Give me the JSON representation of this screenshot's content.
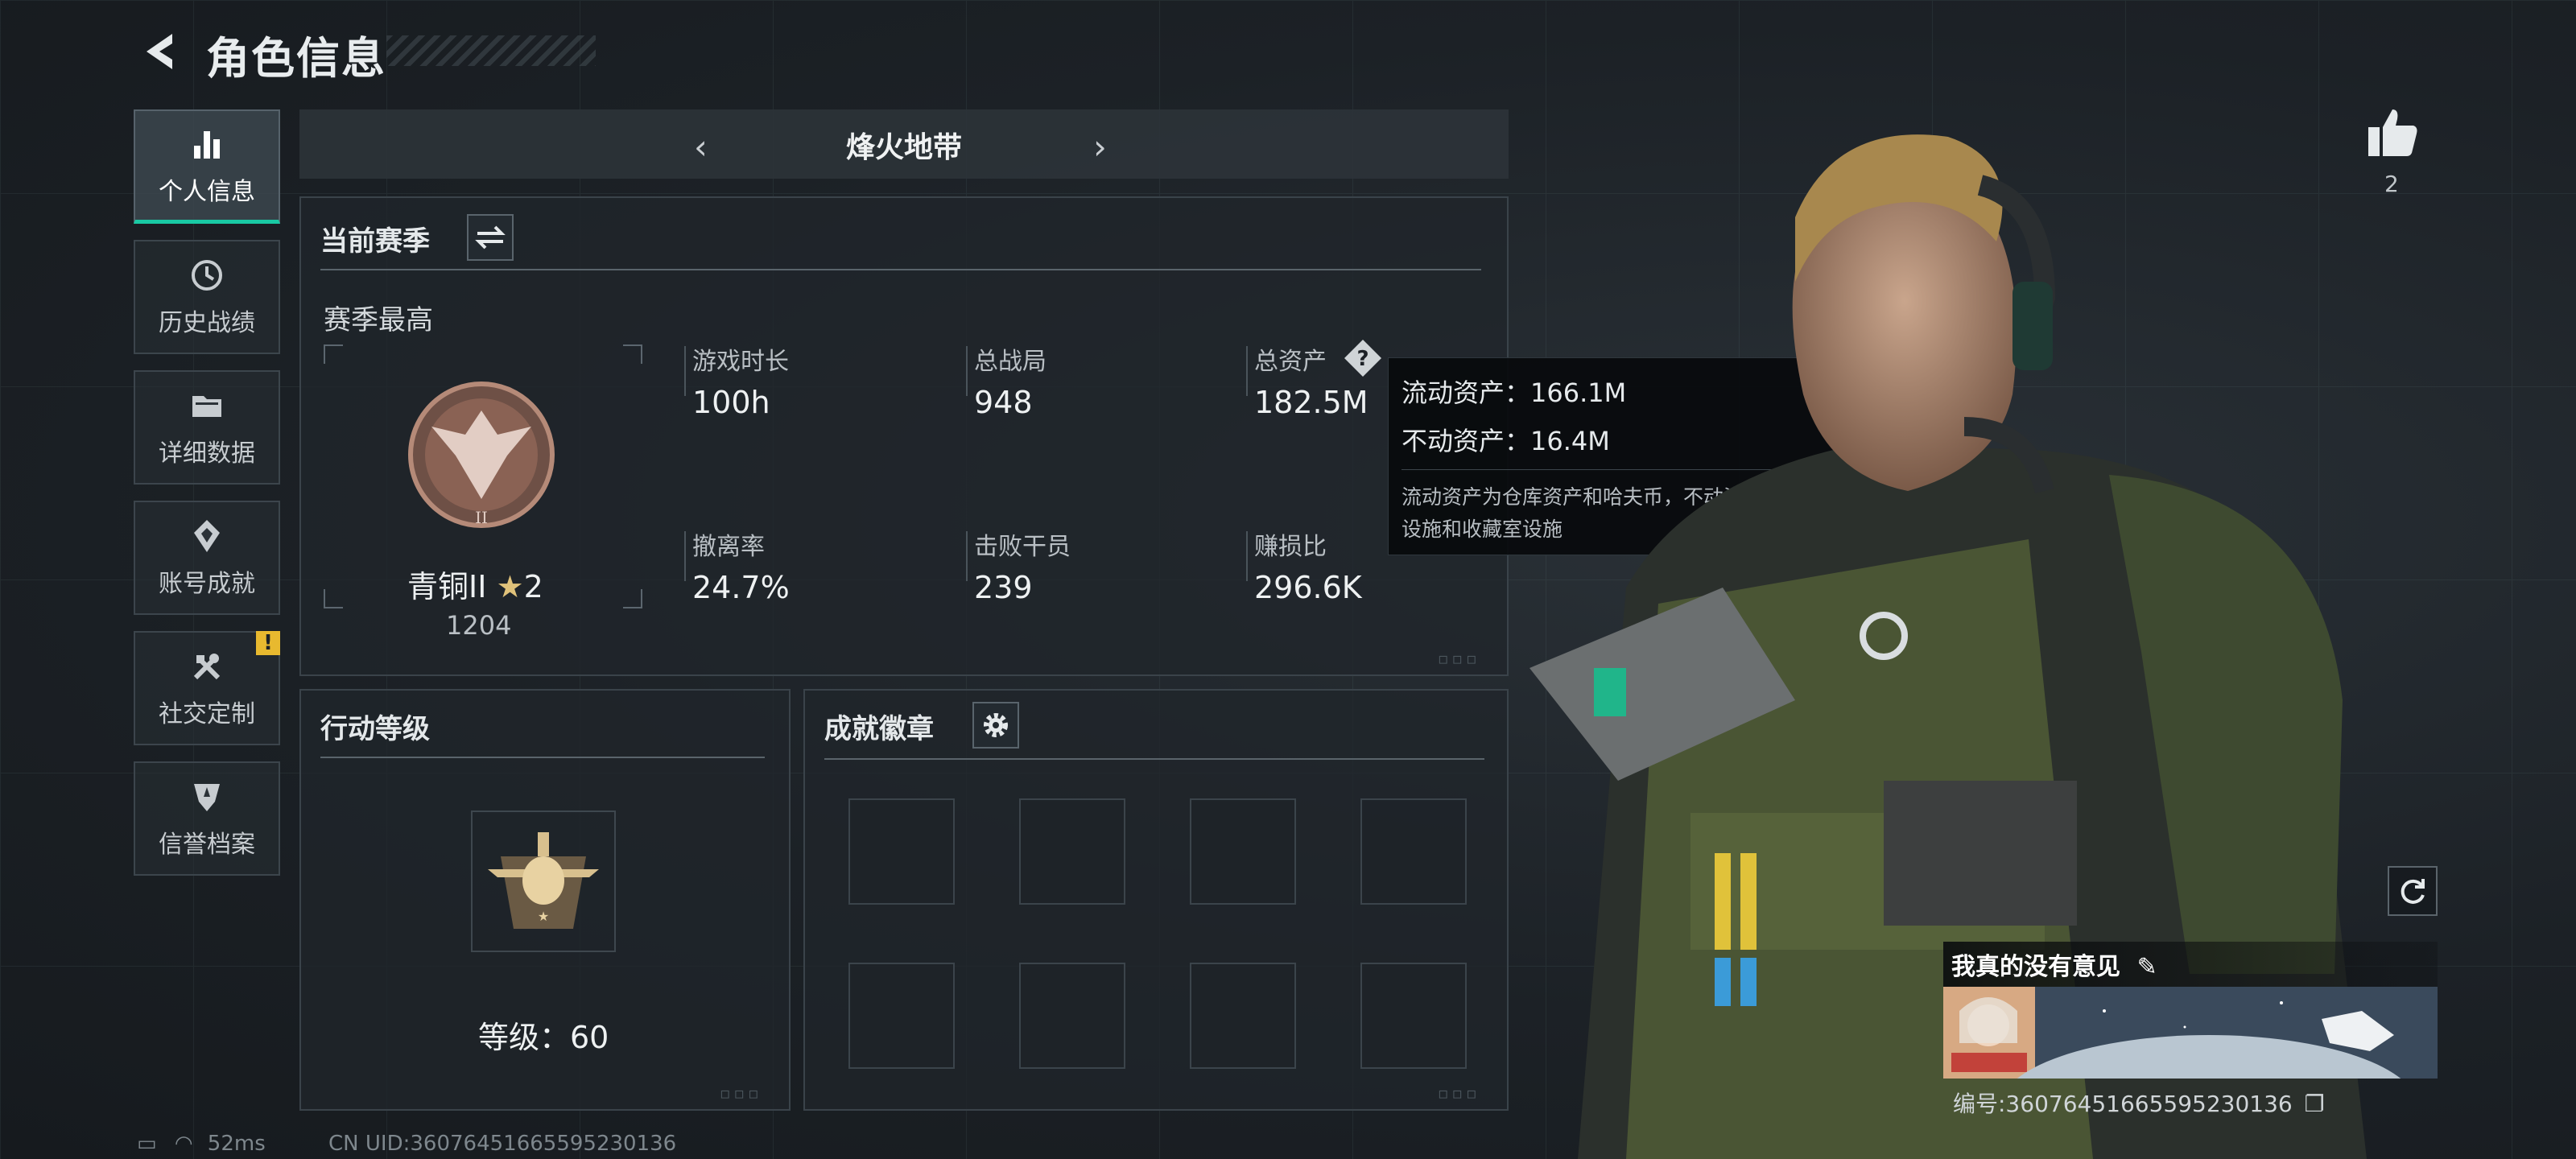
{
  "header": {
    "title": "角色信息"
  },
  "nav": {
    "items": [
      {
        "label": "个人信息",
        "icon": "bar-chart-icon",
        "active": true
      },
      {
        "label": "历史战绩",
        "icon": "history-icon"
      },
      {
        "label": "详细数据",
        "icon": "folder-icon"
      },
      {
        "label": "账号成就",
        "icon": "achievement-icon"
      },
      {
        "label": "社交定制",
        "icon": "tools-icon",
        "badge": "!"
      },
      {
        "label": "信誉档案",
        "icon": "shield-icon"
      }
    ]
  },
  "mode_tabs": {
    "current": "烽火地带"
  },
  "season": {
    "title": "当前赛季",
    "subtitle": "赛季最高",
    "rank": {
      "name": "青铜II",
      "stars": "2",
      "points": "1204"
    },
    "stats": [
      {
        "label": "游戏时长",
        "value": "100h"
      },
      {
        "label": "总战局",
        "value": "948"
      },
      {
        "label": "总资产",
        "value": "182.5M"
      },
      {
        "label": "撤离率",
        "value": "24.7%"
      },
      {
        "label": "击败干员",
        "value": "239"
      },
      {
        "label": "赚损比",
        "value": "296.6K"
      }
    ]
  },
  "tooltip": {
    "liquid": "流动资产：166.1M",
    "fixed": "不动资产：16.4M",
    "note_line1": "流动资产为仓库资产和哈夫币，不动资产为特勤处",
    "note_line2": "设施和收藏室设施"
  },
  "action_level": {
    "title": "行动等级",
    "level_text": "等级：60"
  },
  "badges": {
    "title": "成就徽章"
  },
  "profile": {
    "likes": "2",
    "player_name": "我真的没有意见",
    "id_text": "编号:360764516655952301​36"
  },
  "status_bar": {
    "ping": "52ms",
    "uid": "CN UID:36076451665595230136"
  },
  "colors": {
    "accent": "#19c9a4",
    "warning": "#e8b92f"
  }
}
